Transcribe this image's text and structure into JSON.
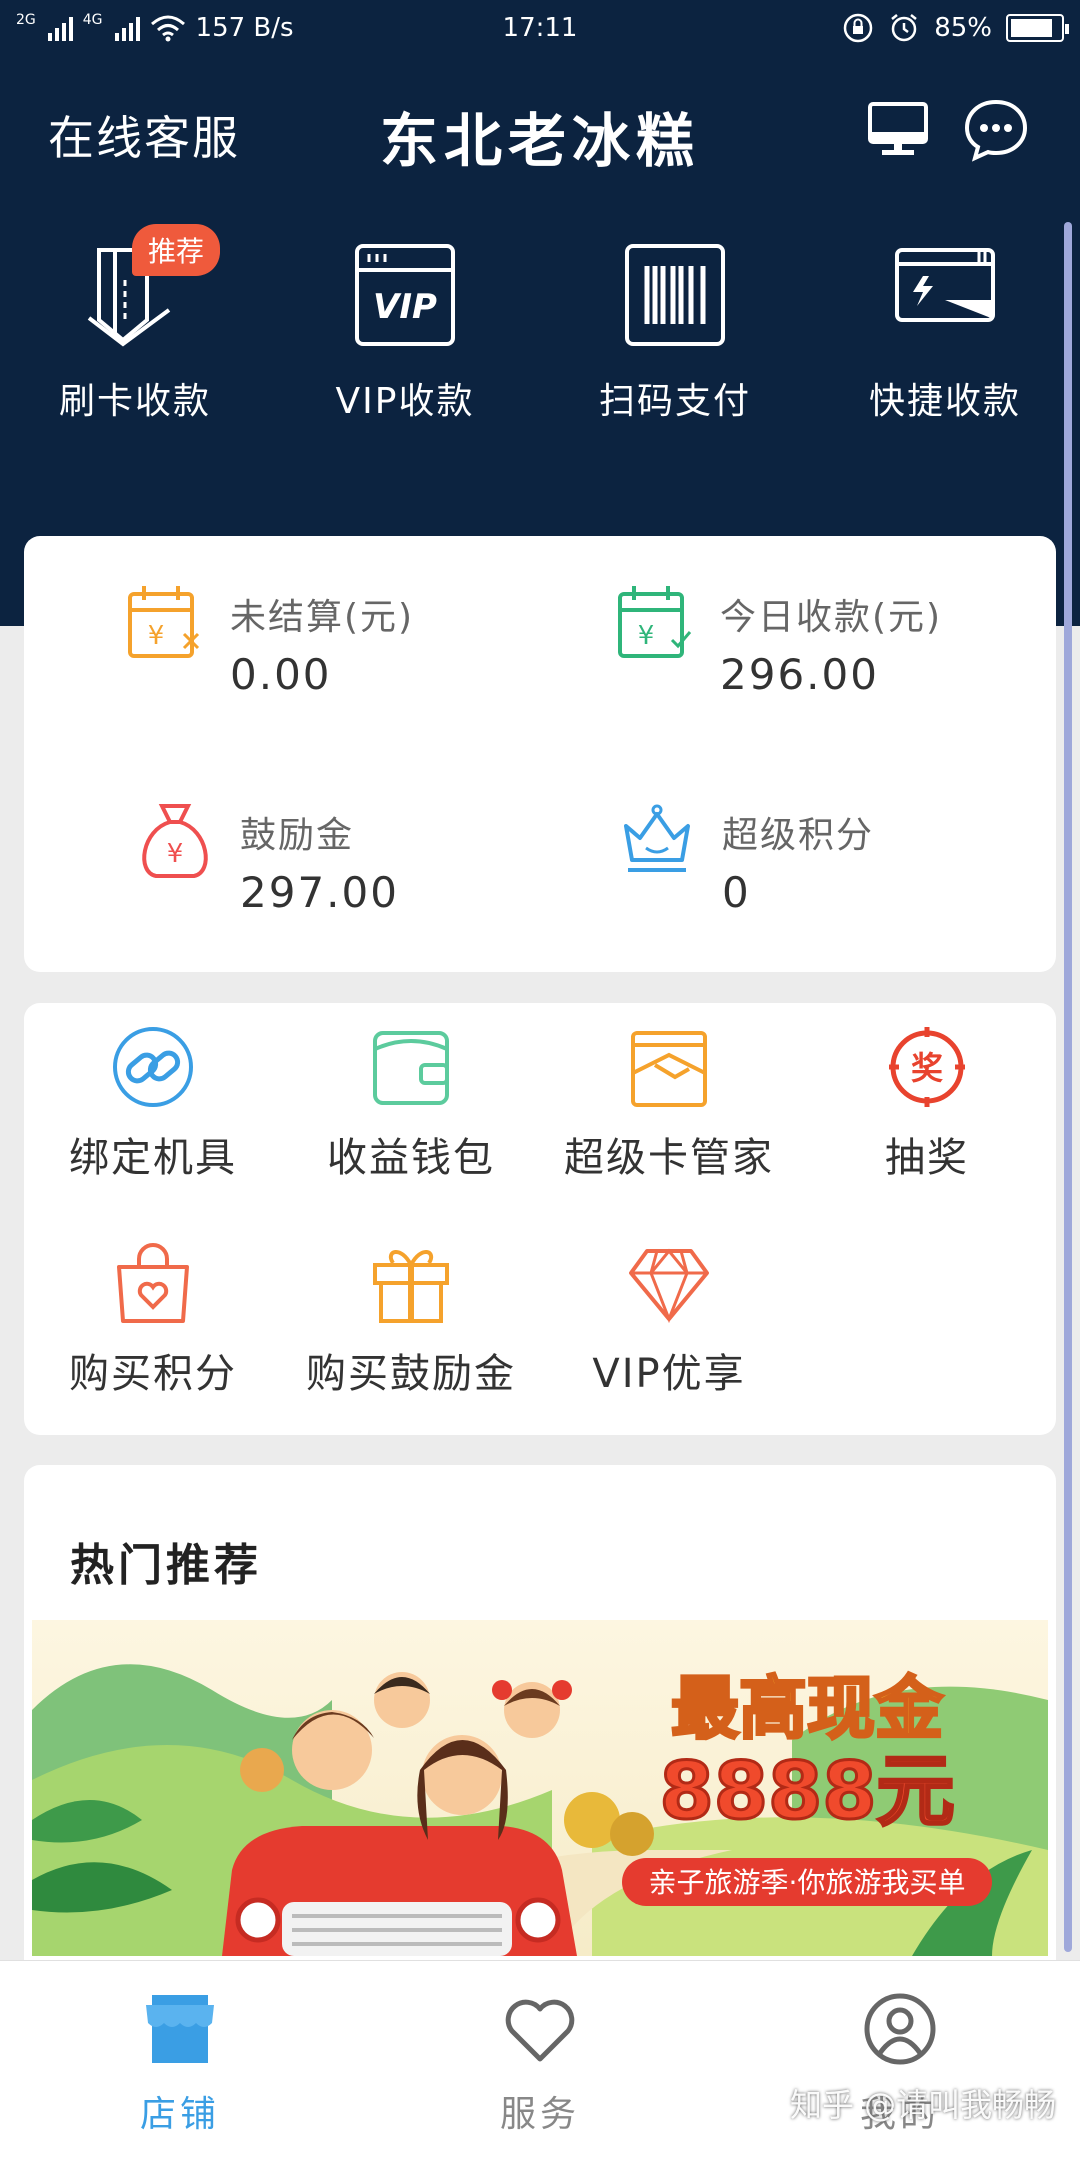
{
  "status_bar": {
    "network_1": "2G",
    "network_2": "4G",
    "speed": "157 B/s",
    "time": "17:11",
    "battery": "85%",
    "battery_level": 0.85
  },
  "header": {
    "service_label": "在线客服",
    "title": "东北老冰糕"
  },
  "quick_actions": [
    {
      "label": "刷卡收款",
      "badge": "推荐"
    },
    {
      "label": "VIP收款",
      "icon_text": "VIP"
    },
    {
      "label": "扫码支付"
    },
    {
      "label": "快捷收款"
    }
  ],
  "stats": [
    {
      "label": "未结算(元)",
      "value": "0.00",
      "icon": "calendar-yen-x-icon",
      "color": "#f5a22c"
    },
    {
      "label": "今日收款(元)",
      "value": "296.00",
      "icon": "calendar-yen-check-icon",
      "color": "#2fb57a"
    },
    {
      "label": "鼓励金",
      "value": "297.00",
      "icon": "money-bag-icon",
      "color": "#ef4f4f"
    },
    {
      "label": "超级积分",
      "value": "0",
      "icon": "crown-icon",
      "color": "#3a9ee4"
    }
  ],
  "tools": [
    {
      "label": "绑定机具",
      "icon": "link-icon",
      "color": "#3a9ee4"
    },
    {
      "label": "收益钱包",
      "icon": "wallet-icon",
      "color": "#5ccb9d"
    },
    {
      "label": "超级卡管家",
      "icon": "card-envelope-icon",
      "color": "#f5a22c"
    },
    {
      "label": "抽奖",
      "icon": "lottery-icon",
      "color": "#e8432e",
      "icon_text": "奖"
    },
    {
      "label": "购买积分",
      "icon": "shopping-bag-heart-icon",
      "color": "#f06a4a"
    },
    {
      "label": "购买鼓励金",
      "icon": "gift-icon",
      "color": "#f5a22c"
    },
    {
      "label": "VIP优享",
      "icon": "diamond-icon",
      "color": "#f06a4a"
    }
  ],
  "hot": {
    "title": "热门推荐",
    "banner_headline_1": "最高现金",
    "banner_headline_2": "8888元",
    "banner_tagline": "亲子旅游季·你旅游我买单"
  },
  "bottom_nav": [
    {
      "label": "店铺",
      "icon": "store-icon",
      "active": true
    },
    {
      "label": "服务",
      "icon": "heart-icon",
      "active": false
    },
    {
      "label": "我的",
      "icon": "user-icon",
      "active": false
    }
  ],
  "watermark": "知乎 @请叫我畅畅",
  "colors": {
    "header_bg": "#0c2340",
    "accent_blue": "#3a9ee4",
    "badge_red": "#ef5a3c"
  }
}
